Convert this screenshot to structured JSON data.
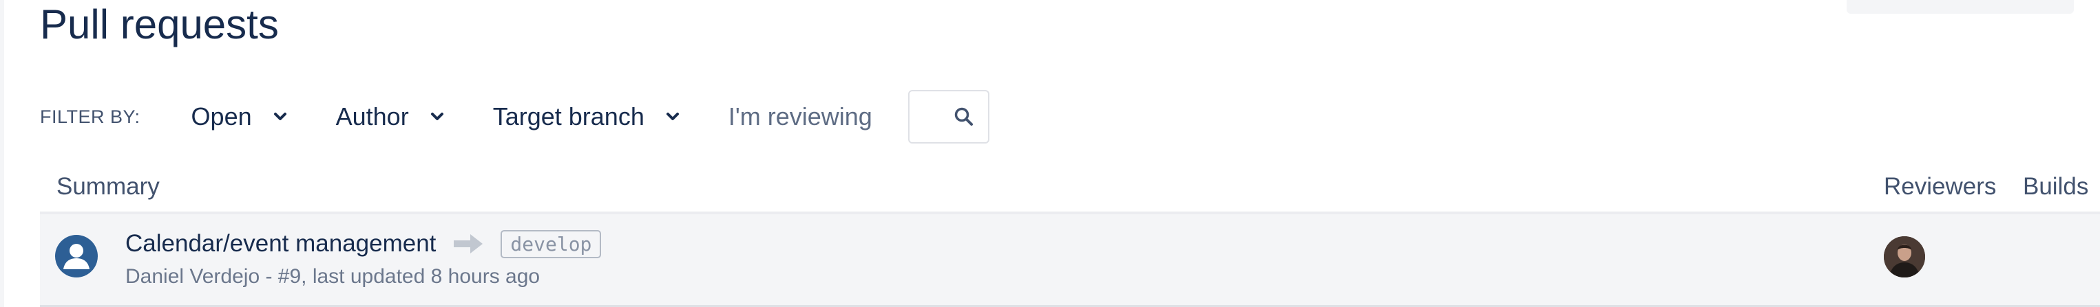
{
  "page": {
    "title": "Pull requests"
  },
  "filters": {
    "label": "FILTER BY:",
    "state": "Open",
    "author": "Author",
    "target_branch": "Target branch",
    "im_reviewing": "I'm reviewing"
  },
  "table": {
    "columns": {
      "summary": "Summary",
      "reviewers": "Reviewers",
      "builds": "Builds"
    },
    "rows": [
      {
        "title": "Calendar/event management",
        "target_branch": "develop",
        "meta": "Daniel Verdejo - #9, last updated 8 hours ago"
      }
    ]
  },
  "icons": {
    "author_avatar": "user-avatar-icon",
    "arrow": "arrow-right-icon",
    "search": "search-icon",
    "chevron": "chevron-down-icon"
  },
  "colors": {
    "title": "#172b4d",
    "muted": "#6b778c",
    "row_bg": "#f4f5f7",
    "avatar_blue": "#2d5f95"
  }
}
